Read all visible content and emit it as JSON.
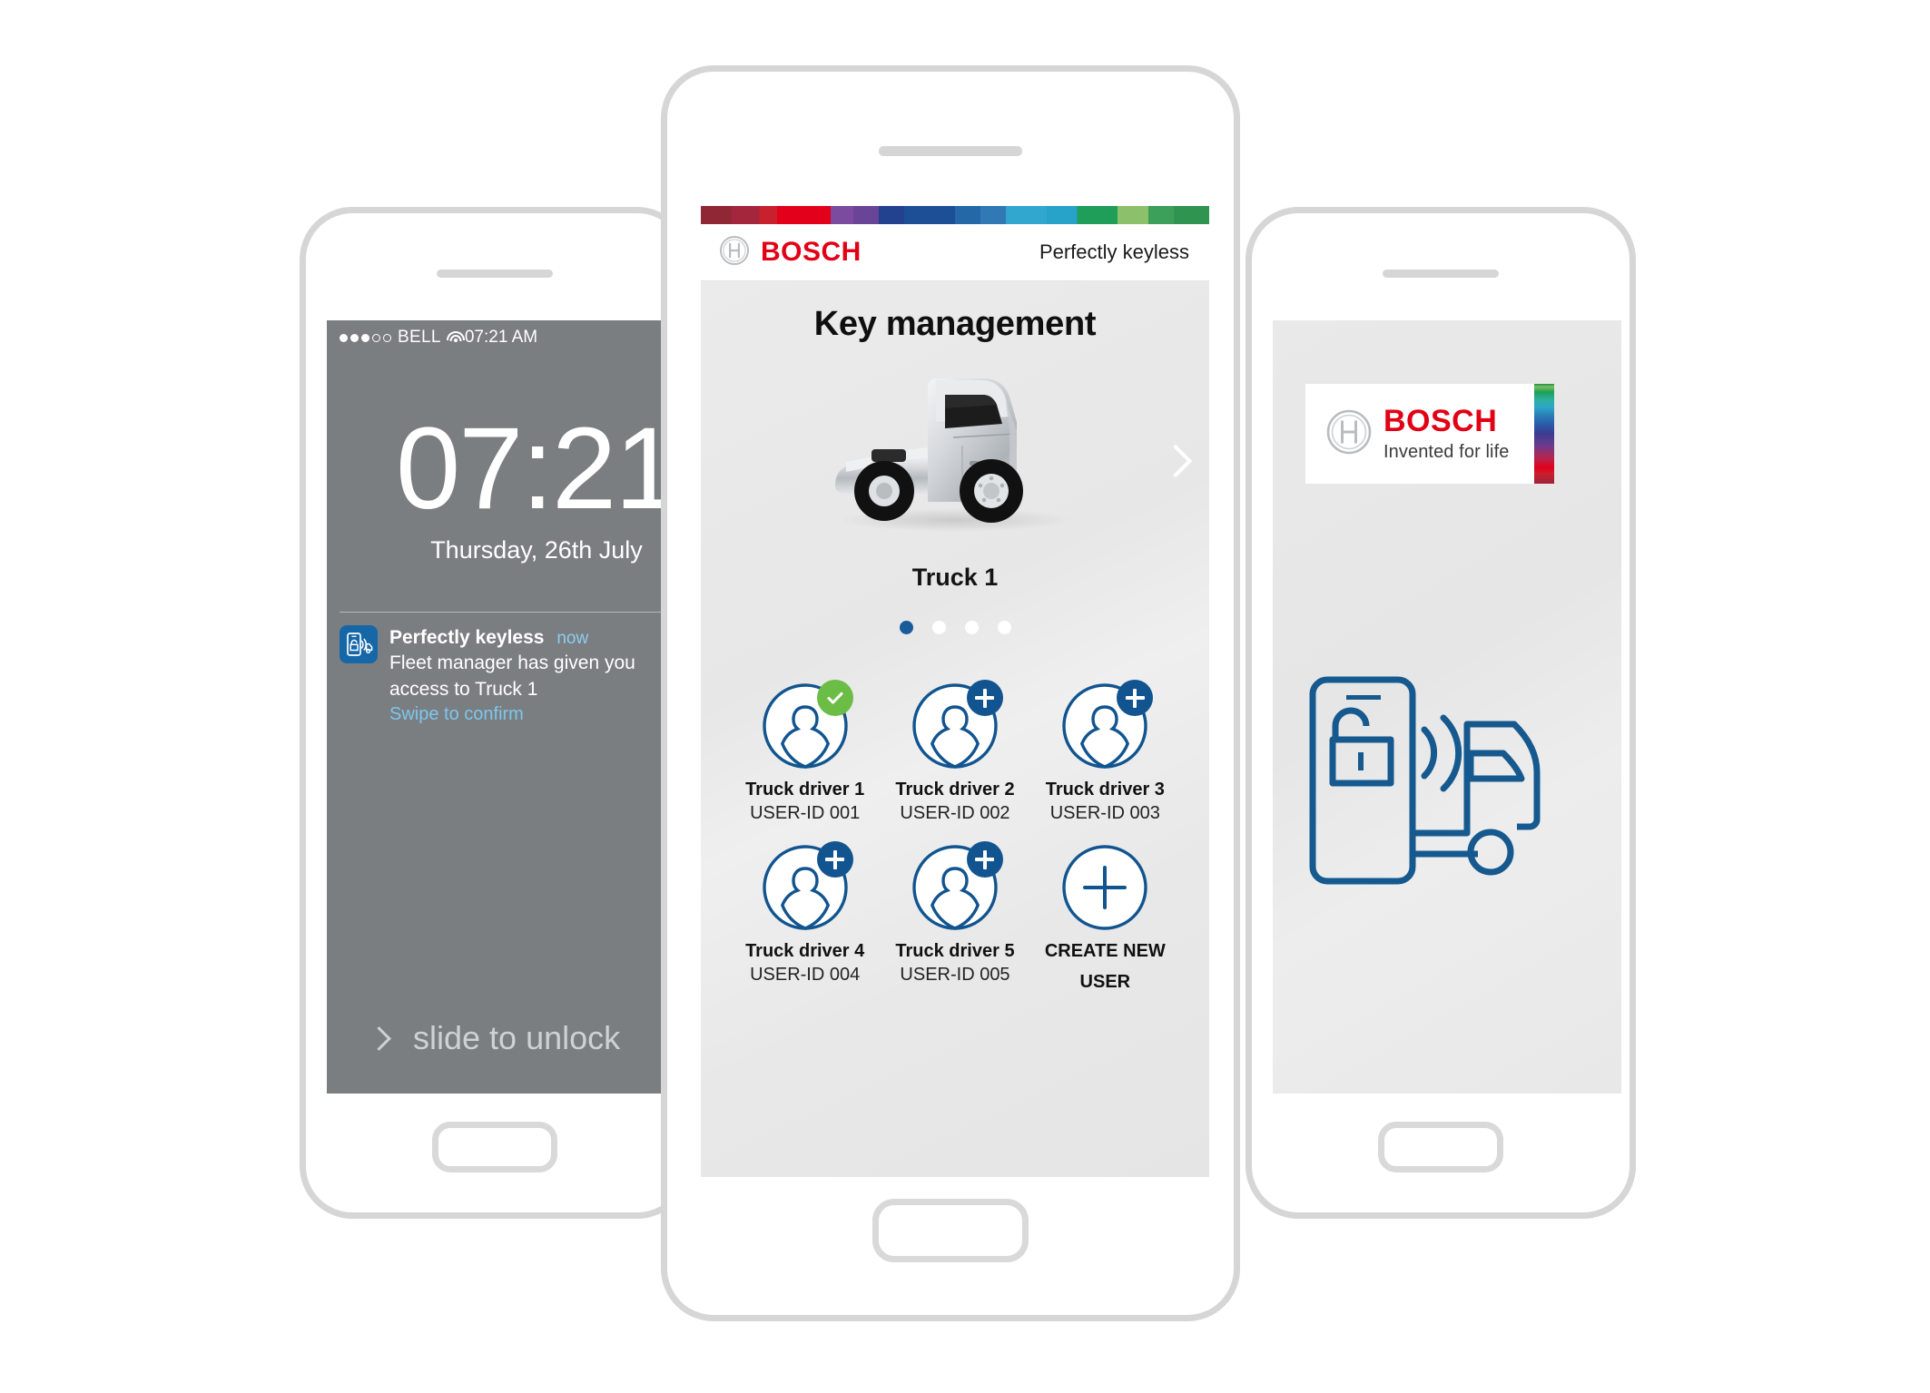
{
  "left_phone": {
    "status_bar": {
      "signal_dots_filled": 3,
      "signal_dots_empty": 2,
      "carrier": "BELL",
      "wifi_icon": "wifi-icon",
      "time": "07:21 AM"
    },
    "lock_screen": {
      "clock": "07:21",
      "date": "Thursday, 26th July",
      "slide_to_unlock": "slide to unlock",
      "slide_chevron_icon": "chevron-right-icon"
    },
    "notification": {
      "app_icon": "perfectly-keyless-app-icon",
      "title": "Perfectly keyless",
      "time": "now",
      "message": "Fleet manager has given you access to Truck 1",
      "action": "Swipe to confirm"
    }
  },
  "center_phone": {
    "app_header": {
      "logo_symbol_icon": "bosch-symbol-icon",
      "brand": "BOSCH",
      "tagline": "Perfectly keyless"
    },
    "screen": {
      "title": "Key management",
      "vehicle_image_icon": "truck-photo",
      "vehicle_name": "Truck 1",
      "next_arrow_icon": "chevron-right-icon",
      "carousel": {
        "total": 4,
        "active_index": 0
      }
    },
    "users": [
      {
        "name": "Truck driver 1",
        "id": "USER-ID 001",
        "badge": "check",
        "badge_icon": "check-icon"
      },
      {
        "name": "Truck driver 2",
        "id": "USER-ID 002",
        "badge": "add",
        "badge_icon": "plus-icon"
      },
      {
        "name": "Truck driver 3",
        "id": "USER-ID 003",
        "badge": "add",
        "badge_icon": "plus-icon"
      },
      {
        "name": "Truck driver 4",
        "id": "USER-ID 004",
        "badge": "add",
        "badge_icon": "plus-icon"
      },
      {
        "name": "Truck driver 5",
        "id": "USER-ID 005",
        "badge": "add",
        "badge_icon": "plus-icon"
      }
    ],
    "create_new_user": {
      "label_line1": "CREATE NEW",
      "label_line2": "USER",
      "icon": "plus-circle-icon"
    }
  },
  "right_phone": {
    "logo": {
      "symbol_icon": "bosch-symbol-icon",
      "brand": "BOSCH",
      "claim": "Invented for life",
      "supergraphic_icon": "bosch-supergraphic"
    },
    "illustration_icon": "phone-unlock-truck-icon"
  },
  "colors": {
    "bosch_red": "#e20015",
    "bosch_blue": "#11548f",
    "bosch_green": "#6cbd45",
    "accent_link": "#7ec6ee",
    "lock_screen_bg": "#7a7e80",
    "phone_frame": "#d6d6d6"
  }
}
